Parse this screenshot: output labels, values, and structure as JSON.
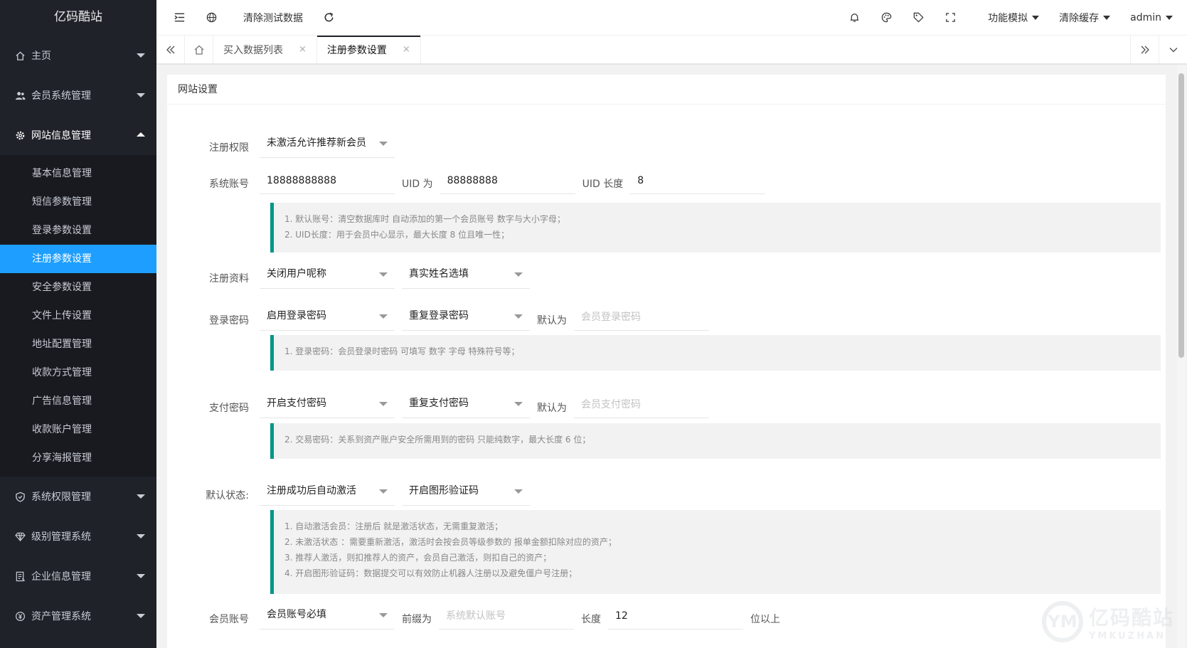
{
  "sidebar": {
    "logo": "亿码酷站",
    "groups_top": [
      {
        "label": "主页",
        "icon": "home-icon"
      },
      {
        "label": "会员系统管理",
        "icon": "users-icon"
      },
      {
        "label": "网站信息管理",
        "icon": "gear-icon"
      }
    ],
    "submenu": [
      "基本信息管理",
      "短信参数管理",
      "登录参数设置",
      "注册参数设置",
      "安全参数设置",
      "文件上传设置",
      "地址配置管理",
      "收款方式管理",
      "广告信息管理",
      "收款账户管理",
      "分享海报管理"
    ],
    "active_sub": "注册参数设置",
    "groups_bottom": [
      {
        "label": "系统权限管理",
        "icon": "shield-icon"
      },
      {
        "label": "级别管理系统",
        "icon": "diamond-icon"
      },
      {
        "label": "企业信息管理",
        "icon": "company-icon"
      },
      {
        "label": "资产管理系统",
        "icon": "yen-icon"
      }
    ]
  },
  "header": {
    "clear_test": "清除测试数据",
    "feature_sim": "功能模拟",
    "clear_cache": "清除缓存",
    "user": "admin"
  },
  "tabs": {
    "items": [
      {
        "label": "买入数据列表",
        "active": false
      },
      {
        "label": "注册参数设置",
        "active": true
      }
    ],
    "close": "×"
  },
  "card": {
    "title": "网站设置"
  },
  "form": {
    "reg_permission": {
      "label": "注册权限",
      "value": "未激活允许推荐新会员"
    },
    "system_account": {
      "label": "系统账号",
      "value": "18888888888",
      "uid_label": "UID 为",
      "uid_value": "88888888",
      "uid_len_label": "UID 长度",
      "uid_len_value": "8"
    },
    "tip1": [
      "1. 默认账号：清空数据库时 自动添加的第一个会员账号 数字与大小字母；",
      "2. UID长度：用于会员中心显示，最大长度 8 位且唯一性；"
    ],
    "reg_info": {
      "label": "注册资料",
      "nickname": "关闭用户呢称",
      "realname": "真实姓名选填"
    },
    "login_pwd": {
      "label": "登录密码",
      "mode": "启用登录密码",
      "repeat": "重复登录密码",
      "default_label": "默认为",
      "placeholder": "会员登录密码"
    },
    "tip2": [
      "1. 登录密码：会员登录时密码 可填写 数字 字母 特殊符号等；"
    ],
    "pay_pwd": {
      "label": "支付密码",
      "mode": "开启支付密码",
      "repeat": "重复支付密码",
      "default_label": "默认为",
      "placeholder": "会员支付密码"
    },
    "tip3": [
      "2. 交易密码：关系到资产账户安全所需用到的密码 只能纯数字，最大长度 6 位；"
    ],
    "default_state": {
      "label": "默认状态:",
      "activate": "注册成功后自动激活",
      "captcha": "开启图形验证码"
    },
    "tip4": [
      "1. 自动激活会员：注册后 就是激活状态，无需重复激活；",
      "2. 未激活状态 ：需要重新激活，激活时会按会员等级参数的 报单金额扣除对应的资产；",
      "3. 推荐人激活，则扣推荐人的资产，会员自己激活，则扣自己的资产；",
      "4. 开启图形验证码：数据提交可以有效防止机器人注册以及避免僵户号注册；"
    ],
    "member_account": {
      "label": "会员账号",
      "mode": "会员账号必填",
      "prefix_label": "前缀为",
      "placeholder": "系统默认账号",
      "len_label": "长度",
      "len_value": "12",
      "extra_label": "位以上"
    }
  },
  "watermark": {
    "main": "亿码酷站",
    "sub": "YMKUZHAN",
    "ring": "YM"
  }
}
